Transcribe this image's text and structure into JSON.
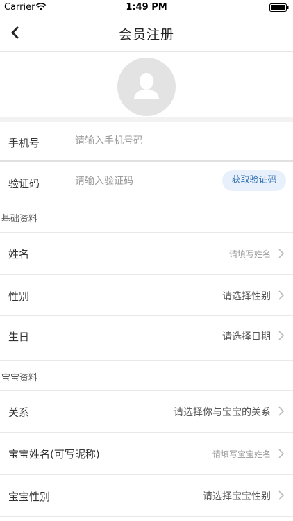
{
  "status_bar": {
    "carrier": "Carrier",
    "time": "1:49 PM"
  },
  "nav": {
    "title": "会员注册"
  },
  "phone": {
    "label": "手机号",
    "placeholder": "请输入手机号码"
  },
  "code": {
    "label": "验证码",
    "placeholder": "请输入验证码",
    "button": "获取验证码"
  },
  "basic": {
    "header": "基础资料",
    "name": {
      "label": "姓名",
      "value": "请填写姓名"
    },
    "gender": {
      "label": "性别",
      "value": "请选择性别"
    },
    "birthday": {
      "label": "生日",
      "value": "请选择日期"
    }
  },
  "baby": {
    "header": "宝宝资料",
    "relation": {
      "label": "关系",
      "value": "请选择你与宝宝的关系"
    },
    "name": {
      "label": "宝宝姓名(可写昵称)",
      "value": "请填写宝宝姓名"
    },
    "gender": {
      "label": "宝宝性别",
      "value": "请选择宝宝性别"
    }
  },
  "colors": {
    "accent": "#2f6fb4",
    "accent_bg": "#e8f1fb",
    "avatar_bg": "#e3e3e3",
    "divider": "#e8e8e8"
  },
  "icons": [
    "wifi-icon",
    "battery-icon",
    "back-chevron-icon",
    "avatar-placeholder-icon",
    "chevron-right-icon"
  ]
}
